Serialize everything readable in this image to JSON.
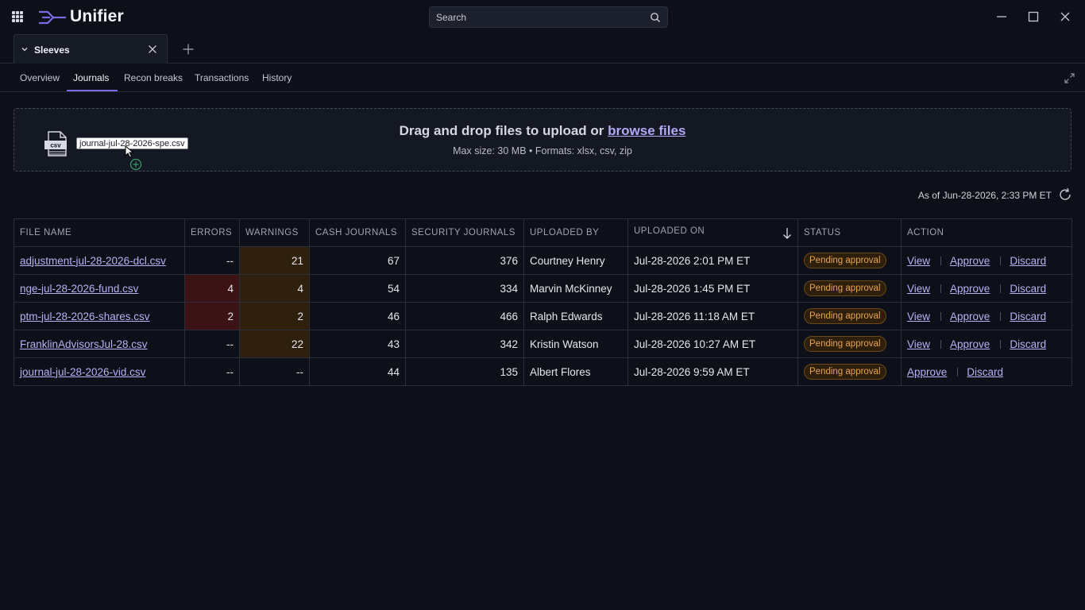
{
  "app": {
    "title": "Unifier"
  },
  "search": {
    "placeholder": "Search"
  },
  "tab": {
    "label": "Sleeves"
  },
  "subnav": [
    {
      "label": "Overview"
    },
    {
      "label": "Journals"
    },
    {
      "label": "Recon breaks"
    },
    {
      "label": "Transactions"
    },
    {
      "label": "History"
    }
  ],
  "subnav_active": "Journals",
  "upload": {
    "title_prefix": "Drag and drop files to upload or ",
    "browse_label": "browse files",
    "subtitle": "Max size: 30 MB  •  Formats: xlsx, csv, zip",
    "file_icon_label": "csv",
    "dragging_file": "journal-jul-28-2026-spe.csv"
  },
  "as_of": "As of Jun-28-2026, 2:33 PM ET",
  "table": {
    "headers": [
      "FILE NAME",
      "ERRORS",
      "WARNINGS",
      "CASH JOURNALS",
      "SECURITY JOURNALS",
      "UPLOADED BY",
      "UPLOADED ON",
      "STATUS",
      "ACTION"
    ],
    "rows": [
      {
        "file": "adjustment-jul-28-2026-dcl.csv",
        "errors": "--",
        "warnings": "21",
        "cash": "67",
        "security": "376",
        "by": "Courtney Henry",
        "on": "Jul-28-2026 2:01 PM ET",
        "status": "Pending approval",
        "actions": [
          "View",
          "Approve",
          "Discard"
        ]
      },
      {
        "file": "nge-jul-28-2026-fund.csv",
        "errors": "4",
        "warnings": "4",
        "cash": "54",
        "security": "334",
        "by": "Marvin McKinney",
        "on": "Jul-28-2026 1:45 PM ET",
        "status": "Pending approval",
        "actions": [
          "View",
          "Approve",
          "Discard"
        ]
      },
      {
        "file": "ptm-jul-28-2026-shares.csv",
        "errors": "2",
        "warnings": "2",
        "cash": "46",
        "security": "466",
        "by": "Ralph Edwards",
        "on": "Jul-28-2026 11:18 AM ET",
        "status": "Pending approval",
        "actions": [
          "View",
          "Approve",
          "Discard"
        ]
      },
      {
        "file": "FranklinAdvisorsJul-28.csv",
        "errors": "--",
        "warnings": "22",
        "cash": "43",
        "security": "342",
        "by": "Kristin Watson",
        "on": "Jul-28-2026 10:27 AM ET",
        "status": "Pending approval",
        "actions": [
          "View",
          "Approve",
          "Discard"
        ]
      },
      {
        "file": "journal-jul-28-2026-vid.csv",
        "errors": "--",
        "warnings": "--",
        "cash": "44",
        "security": "135",
        "by": "Albert Flores",
        "on": "Jul-28-2026 9:59 AM ET",
        "status": "Pending approval",
        "actions": [
          "Approve",
          "Discard"
        ]
      }
    ]
  },
  "colors": {
    "accent": "#7b6be0",
    "link": "#b9b0f5",
    "error_cell": "#3b1314",
    "warning_cell": "#2f1f0d",
    "pending_badge": "#e8a44e"
  }
}
